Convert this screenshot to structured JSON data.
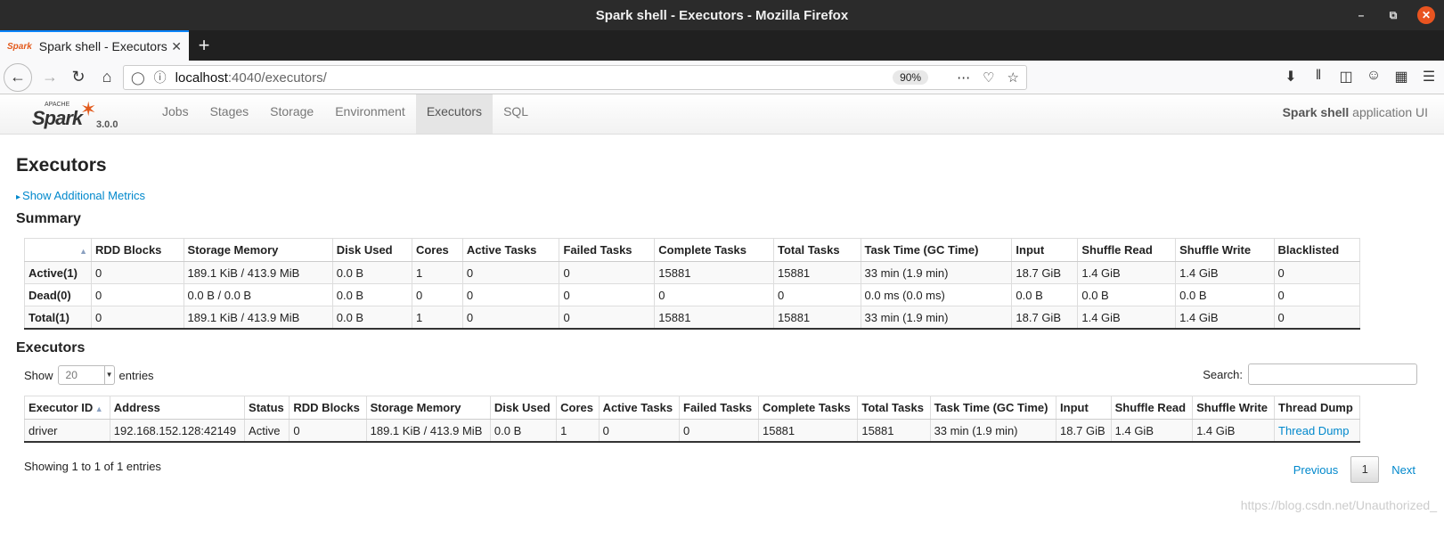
{
  "window": {
    "title": "Spark shell - Executors - Mozilla Firefox"
  },
  "tab": {
    "label": "Spark shell - Executors",
    "favicon": "Spark"
  },
  "url": {
    "host": "localhost",
    "path": ":4040/executors/",
    "zoom": "90%"
  },
  "spark": {
    "logo_top": "APACHE",
    "logo": "Spark",
    "version": "3.0.0",
    "nav": [
      "Jobs",
      "Stages",
      "Storage",
      "Environment",
      "Executors",
      "SQL"
    ],
    "active_nav": "Executors",
    "app_name_bold": "Spark shell",
    "app_name_suffix": " application UI"
  },
  "page": {
    "title": "Executors",
    "additional_metrics": "Show Additional Metrics",
    "summary_title": "Summary",
    "executors_title": "Executors"
  },
  "summary": {
    "headers": [
      "",
      "RDD Blocks",
      "Storage Memory",
      "Disk Used",
      "Cores",
      "Active Tasks",
      "Failed Tasks",
      "Complete Tasks",
      "Total Tasks",
      "Task Time (GC Time)",
      "Input",
      "Shuffle Read",
      "Shuffle Write",
      "Blacklisted"
    ],
    "rows": [
      [
        "Active(1)",
        "0",
        "189.1 KiB / 413.9 MiB",
        "0.0 B",
        "1",
        "0",
        "0",
        "15881",
        "15881",
        "33 min (1.9 min)",
        "18.7 GiB",
        "1.4 GiB",
        "1.4 GiB",
        "0"
      ],
      [
        "Dead(0)",
        "0",
        "0.0 B / 0.0 B",
        "0.0 B",
        "0",
        "0",
        "0",
        "0",
        "0",
        "0.0 ms (0.0 ms)",
        "0.0 B",
        "0.0 B",
        "0.0 B",
        "0"
      ],
      [
        "Total(1)",
        "0",
        "189.1 KiB / 413.9 MiB",
        "0.0 B",
        "1",
        "0",
        "0",
        "15881",
        "15881",
        "33 min (1.9 min)",
        "18.7 GiB",
        "1.4 GiB",
        "1.4 GiB",
        "0"
      ]
    ]
  },
  "executors": {
    "show_label": "Show",
    "entries_label": "entries",
    "page_size": "20",
    "search_label": "Search:",
    "headers": [
      "Executor ID",
      "Address",
      "Status",
      "RDD Blocks",
      "Storage Memory",
      "Disk Used",
      "Cores",
      "Active Tasks",
      "Failed Tasks",
      "Complete Tasks",
      "Total Tasks",
      "Task Time (GC Time)",
      "Input",
      "Shuffle Read",
      "Shuffle Write",
      "Thread Dump"
    ],
    "rows": [
      [
        "driver",
        "192.168.152.128:42149",
        "Active",
        "0",
        "189.1 KiB / 413.9 MiB",
        "0.0 B",
        "1",
        "0",
        "0",
        "15881",
        "15881",
        "33 min (1.9 min)",
        "18.7 GiB",
        "1.4 GiB",
        "1.4 GiB",
        "Thread Dump"
      ]
    ],
    "showing": "Showing 1 to 1 of 1 entries",
    "previous": "Previous",
    "current_page": "1",
    "next": "Next"
  },
  "watermark": "https://blog.csdn.net/Unauthorized_"
}
